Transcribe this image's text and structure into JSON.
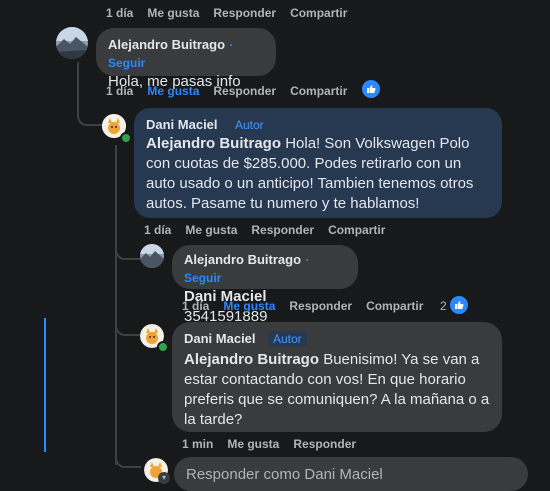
{
  "top_actions": {
    "time": "1 día",
    "like": "Me gusta",
    "reply": "Responder",
    "share": "Compartir"
  },
  "c1": {
    "author": "Alejandro Buitrago",
    "follow": "Seguir",
    "text": "Hola, me pasas info",
    "time": "1 día",
    "like": "Me gusta",
    "reply": "Responder",
    "share": "Compartir"
  },
  "c2": {
    "author": "Dani Maciel",
    "badge": "Autor",
    "mention": "Alejandro Buitrago",
    "text": "Hola! Son Volkswagen Polo con cuotas de $285.000. Podes retirarlo con un auto usado o un anticipo! Tambien tenemos otros autos. Pasame tu numero y te hablamos!",
    "time": "1 día",
    "like": "Me gusta",
    "reply": "Responder",
    "share": "Compartir"
  },
  "c3": {
    "author": "Alejandro Buitrago",
    "follow": "Seguir",
    "mention": "Dani Maciel",
    "text": "3541591889",
    "time": "1 día",
    "like": "Me gusta",
    "reply": "Responder",
    "share": "Compartir",
    "reactions": "2"
  },
  "c4": {
    "author": "Dani Maciel",
    "badge": "Autor",
    "mention": "Alejandro Buitrago",
    "text": "Buenisimo! Ya se van a estar contactando con vos! En que horario preferis que se comuniquen? A la mañana o a la tarde?",
    "time": "1 min",
    "like": "Me gusta",
    "reply": "Responder"
  },
  "reply_box": {
    "placeholder": "Responder como Dani Maciel"
  },
  "colors": {
    "accent": "#2d88ff",
    "bg": "#18191a",
    "bubble": "#3a3b3c",
    "highlight": "#263951"
  }
}
